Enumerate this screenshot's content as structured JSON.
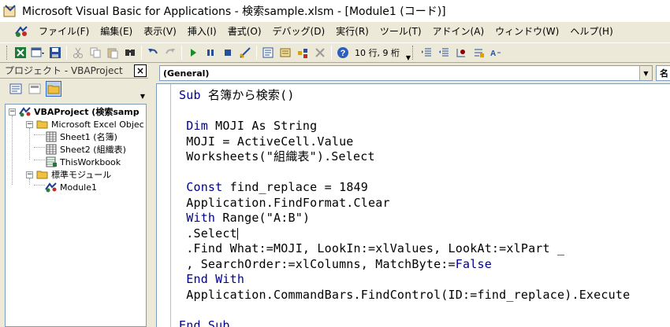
{
  "window": {
    "title": "Microsoft Visual Basic for Applications - 検索sample.xlsm - [Module1 (コード)]"
  },
  "menu": {
    "items": [
      "ファイル(F)",
      "編集(E)",
      "表示(V)",
      "挿入(I)",
      "書式(O)",
      "デバッグ(D)",
      "実行(R)",
      "ツール(T)",
      "アドイン(A)",
      "ウィンドウ(W)",
      "ヘルプ(H)"
    ]
  },
  "toolbar": {
    "position_text": "10 行, 9 桁"
  },
  "project_panel": {
    "title": "プロジェクト - VBAProject",
    "close_label": "×",
    "tree": {
      "root": "VBAProject (検索samp",
      "excel_objects": "Microsoft Excel Objec",
      "sheet1": "Sheet1 (名簿)",
      "sheet2": "Sheet2 (組織表)",
      "thisworkbook": "ThisWorkbook",
      "modules": "標準モジュール",
      "module1": "Module1"
    }
  },
  "code": {
    "object_combo": "(General)",
    "procedure_combo": "名",
    "lines": [
      {
        "pre": "",
        "kw": "Sub",
        "post": " 名簿から検索()"
      },
      {
        "pre": "",
        "kw": "",
        "post": ""
      },
      {
        "pre": " ",
        "kw": "Dim",
        "post": " MOJI As String"
      },
      {
        "pre": " ",
        "kw": "",
        "post": "MOJI = ActiveCell.Value"
      },
      {
        "pre": " ",
        "kw": "",
        "post": "Worksheets(\"組織表\").Select"
      },
      {
        "pre": "",
        "kw": "",
        "post": ""
      },
      {
        "pre": " ",
        "kw": "Const",
        "post": " find_replace = 1849"
      },
      {
        "pre": " ",
        "kw": "",
        "post": "Application.FindFormat.Clear"
      },
      {
        "pre": " ",
        "kw": "With",
        "post": " Range(\"A:B\")"
      },
      {
        "pre": " ",
        "kw": "",
        "post": ".Select"
      },
      {
        "pre": " ",
        "kw": "",
        "post": ".Find What:=MOJI, LookIn:=xlValues, LookAt:=xlPart _"
      },
      {
        "pre": " ",
        "kw": "",
        "post": ", SearchOrder:=xlColumns, MatchByte:=False"
      },
      {
        "pre": " ",
        "kw": "End With",
        "post": ""
      },
      {
        "pre": " ",
        "kw": "",
        "post": "Application.CommandBars.FindControl(ID:=find_replace).Execute"
      },
      {
        "pre": "",
        "kw": "",
        "post": ""
      },
      {
        "pre": "",
        "kw": "End Sub",
        "post": ""
      }
    ]
  }
}
